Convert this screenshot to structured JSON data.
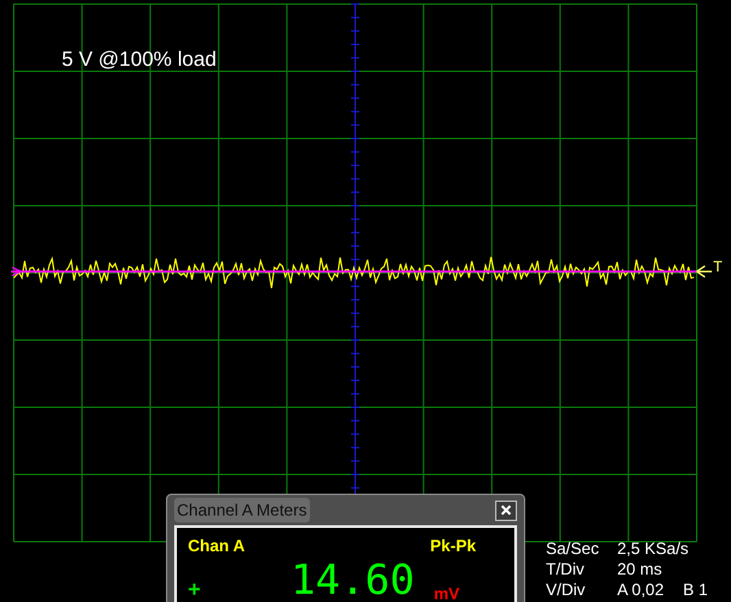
{
  "screen": {
    "label": "5 V @100% load",
    "trigger_marker": "T"
  },
  "meter_window": {
    "title": "Channel A Meters",
    "channel": "Chan A",
    "measurement": "Pk-Pk",
    "polarity": "+",
    "value": "14.60",
    "unit": "mV"
  },
  "readouts": [
    {
      "label": "Sa/Sec",
      "value": "2,5 KSa/s"
    },
    {
      "label": "T/Div",
      "value": "20 ms"
    },
    {
      "label": "V/Div",
      "value": "A 0,02",
      "extra": "B 1"
    }
  ]
}
